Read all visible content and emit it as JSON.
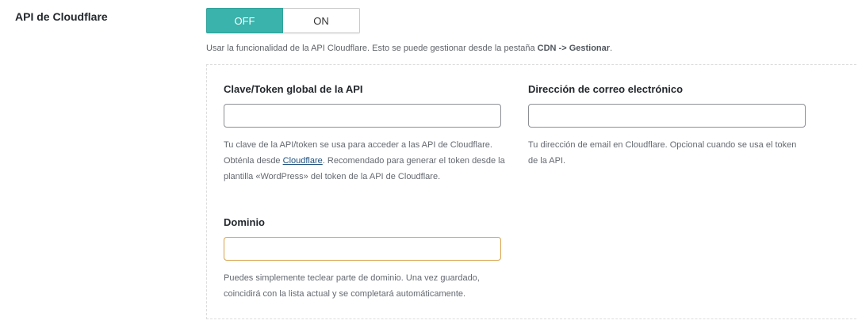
{
  "setting": {
    "label": "API de Cloudflare"
  },
  "toggle": {
    "off_label": "OFF",
    "on_label": "ON",
    "selected": "OFF",
    "active_color": "#39b3ab"
  },
  "description": {
    "text_before": "Usar la funcionalidad de la API Cloudflare. Esto se puede gestionar desde la pestaña",
    "tab_name": "CDN -> Gestionar",
    "text_after": "."
  },
  "fields": {
    "api_key": {
      "label": "Clave/Token global de la API",
      "value": "",
      "desc_part1": "Tu clave de la API/token se usa para acceder a las API de Cloudflare. Obténla desde",
      "desc_link": "Cloudflare",
      "desc_part2": ". Recomendado para generar el token desde la plantilla «WordPress» del token de la API de Cloudflare."
    },
    "email": {
      "label": "Dirección de correo electrónico",
      "value": "",
      "desc": "Tu dirección de email en Cloudflare. Opcional cuando se usa el token de la API."
    },
    "domain": {
      "label": "Dominio",
      "value": "",
      "desc": "Puedes simplemente teclear parte de dominio. Una vez guardado, coincidirá con la lista actual y se completará automáticamente."
    }
  }
}
